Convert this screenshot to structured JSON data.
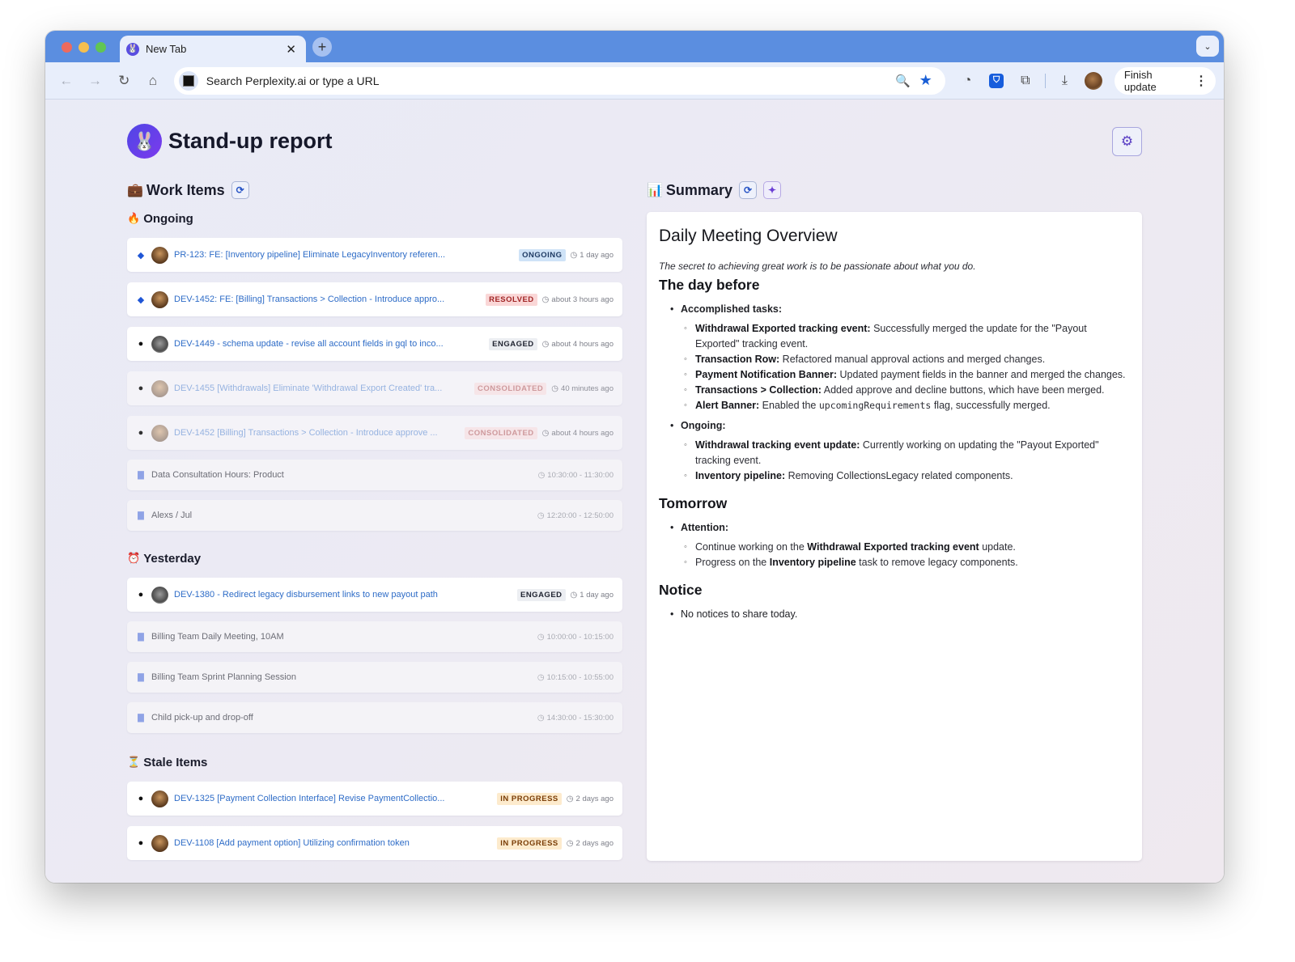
{
  "browser": {
    "tab_title": "New Tab",
    "omnibox_placeholder": "Search Perplexity.ai or type a URL",
    "finish_update_label": "Finish update"
  },
  "page": {
    "title": "Stand-up report"
  },
  "work_items": {
    "title": "Work Items",
    "sections": [
      {
        "title": "Ongoing",
        "emoji": "🔥",
        "items": [
          {
            "source": "jira",
            "avatar": "person",
            "title": "PR-123: FE: [Inventory pipeline] Eliminate LegacyInventory referen...",
            "status": "ONGOING",
            "status_kind": "ongoing",
            "time": "1 day ago",
            "faded": false
          },
          {
            "source": "jira",
            "avatar": "person",
            "title": "DEV-1452: FE: [Billing] Transactions > Collection - Introduce appro...",
            "status": "RESOLVED",
            "status_kind": "resolved",
            "time": "about 3 hours ago",
            "faded": false
          },
          {
            "source": "github",
            "avatar": "bot",
            "title": "DEV-1449 - schema update - revise all account fields in gql to inco...",
            "status": "ENGAGED",
            "status_kind": "engaged",
            "time": "about 4 hours ago",
            "faded": false
          },
          {
            "source": "github",
            "avatar": "person",
            "title": "DEV-1455 [Withdrawals] Eliminate 'Withdrawal Export Created' tra...",
            "status": "CONSOLIDATED",
            "status_kind": "consolidated",
            "time": "40 minutes ago",
            "faded": true
          },
          {
            "source": "github",
            "avatar": "person",
            "title": "DEV-1452 [Billing] Transactions > Collection - Introduce approve ...",
            "status": "CONSOLIDATED",
            "status_kind": "consolidated",
            "time": "about 4 hours ago",
            "faded": true
          },
          {
            "source": "calendar",
            "title": "Data Consultation Hours: Product",
            "time": "10:30:00 - 11:30:00"
          },
          {
            "source": "calendar",
            "title": "Alexs / Jul",
            "time": "12:20:00 - 12:50:00"
          }
        ]
      },
      {
        "title": "Yesterday",
        "emoji": "⏰",
        "items": [
          {
            "source": "github",
            "avatar": "bot",
            "title": "DEV-1380 - Redirect legacy disbursement links to new payout path",
            "status": "ENGAGED",
            "status_kind": "engaged",
            "time": "1 day ago",
            "faded": false
          },
          {
            "source": "calendar",
            "title": "Billing Team Daily Meeting, 10AM",
            "time": "10:00:00 - 10:15:00"
          },
          {
            "source": "calendar",
            "title": "Billing Team Sprint Planning Session",
            "time": "10:15:00 - 10:55:00"
          },
          {
            "source": "calendar",
            "title": "Child pick-up and drop-off",
            "time": "14:30:00 - 15:30:00"
          }
        ]
      },
      {
        "title": "Stale Items",
        "emoji": "⏳",
        "items": [
          {
            "source": "github",
            "avatar": "person",
            "title": "DEV-1325 [Payment Collection Interface] Revise PaymentCollectio...",
            "status": "IN PROGRESS",
            "status_kind": "inprogress",
            "time": "2 days ago",
            "faded": false
          },
          {
            "source": "github",
            "avatar": "person",
            "title": "DEV-1108 [Add payment option] Utilizing confirmation token",
            "status": "IN PROGRESS",
            "status_kind": "inprogress",
            "time": "2 days ago",
            "faded": false
          }
        ]
      }
    ]
  },
  "summary": {
    "title": "Summary",
    "heading": "Daily Meeting Overview",
    "quote": "The secret to achieving great work is to be passionate about what you do.",
    "day_before": {
      "heading": "The day before",
      "accomplished_label": "Accomplished tasks:",
      "accomplished": [
        {
          "bold": "Withdrawal Exported tracking event:",
          "text": " Successfully merged the update for the \"Payout Exported\" tracking event."
        },
        {
          "bold": "Transaction Row:",
          "text": " Refactored manual approval actions and merged changes."
        },
        {
          "bold": "Payment Notification Banner:",
          "text": " Updated payment fields in the banner and merged the changes."
        },
        {
          "bold": "Transactions > Collection:",
          "text": " Added approve and decline buttons, which have been merged."
        },
        {
          "bold": "Alert Banner:",
          "text_before": " Enabled the ",
          "code": "upcomingRequirements",
          "text": " flag, successfully merged."
        }
      ],
      "ongoing_label": "Ongoing:",
      "ongoing": [
        {
          "bold": "Withdrawal tracking event update:",
          "text": " Currently working on updating the \"Payout Exported\" tracking event."
        },
        {
          "bold": "Inventory pipeline:",
          "text": " Removing CollectionsLegacy related components."
        }
      ]
    },
    "tomorrow": {
      "heading": "Tomorrow",
      "attention_label": "Attention:",
      "items": [
        {
          "before": "Continue working on the ",
          "bold": "Withdrawal Exported tracking event",
          "after": " update."
        },
        {
          "before": "Progress on the ",
          "bold": "Inventory pipeline",
          "after": " task to remove legacy components."
        }
      ]
    },
    "notice": {
      "heading": "Notice",
      "items": [
        "No notices to share today."
      ]
    }
  }
}
